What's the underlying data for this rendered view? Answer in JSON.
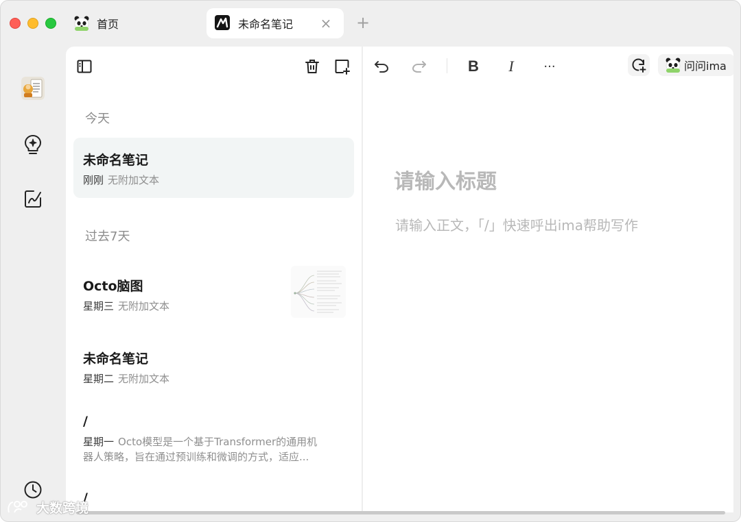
{
  "tabs": {
    "home_label": "首页",
    "active_label": "未命名笔记",
    "close_glyph": "×",
    "add_glyph": "+"
  },
  "rail": {
    "icons": [
      "avatar",
      "lightbulb-sparkle-icon",
      "edit-note-icon",
      "clock-icon"
    ]
  },
  "notes_list": {
    "sections": [
      {
        "label": "今天",
        "items": [
          {
            "title": "未命名笔记",
            "when": "刚刚",
            "preview": "无附加文本",
            "selected": true
          }
        ]
      },
      {
        "label": "过去7天",
        "items": [
          {
            "title": "Octo脑图",
            "when": "星期三",
            "preview": "无附加文本",
            "has_thumbnail": true
          },
          {
            "title": "未命名笔记",
            "when": "星期二",
            "preview": "无附加文本"
          },
          {
            "title": "/",
            "when": "星期一",
            "preview_line1": "Octo模型是一个基于Transformer的通用机",
            "preview_line2": "器人策略，旨在通过预训练和微调的方式，适应..."
          },
          {
            "title": "/"
          }
        ]
      }
    ]
  },
  "editor": {
    "toolbar": {
      "bold_label": "B",
      "italic_label": "I",
      "more_label": "···",
      "ask_label": "问问ima"
    },
    "title_placeholder": "请输入标题",
    "body_placeholder": "请输入正文，「/」快速呼出ima帮助写作"
  },
  "watermark": {
    "text": "大数跨境"
  },
  "colors": {
    "selected_row": "#f2f5f5",
    "placeholder": "#b8b8b8",
    "window_bg": "#efefef"
  }
}
